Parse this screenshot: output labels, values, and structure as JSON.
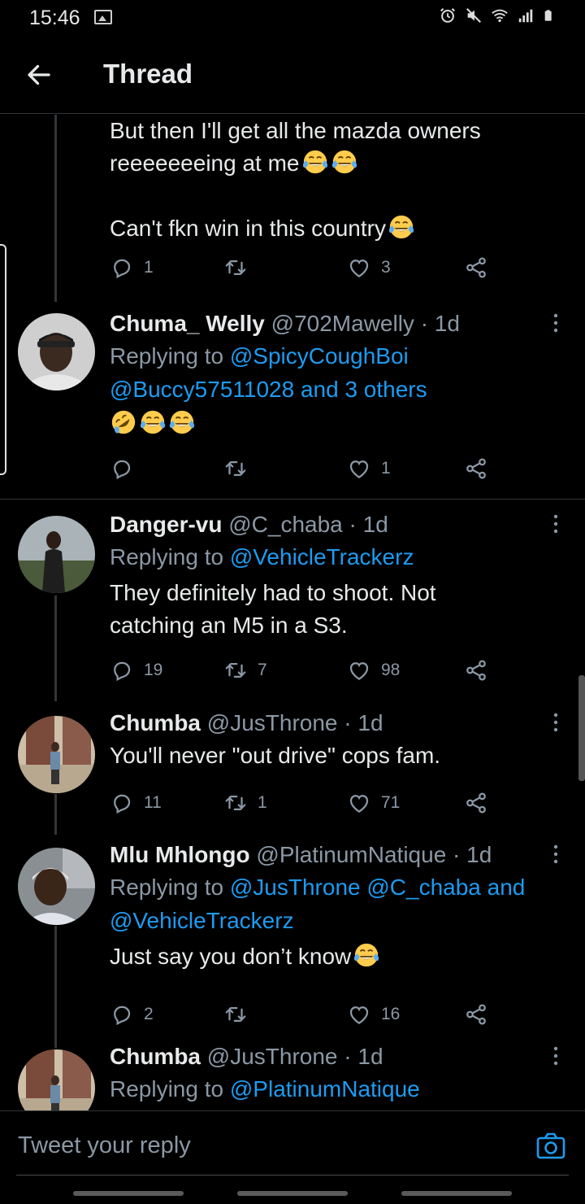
{
  "status_bar": {
    "time": "15:46"
  },
  "header": {
    "title": "Thread"
  },
  "tweets": [
    {
      "lines": [
        "But then I'll get all the mazda owners",
        "reeeeeeeing at me",
        "Can't fkn win in this country"
      ],
      "counts": {
        "replies": "1",
        "retweets": "",
        "likes": "3"
      }
    },
    {
      "name": "Chuma_ Welly",
      "handle": "@702Mawelly · 1d",
      "replying_prefix": "Replying to ",
      "replying_links": [
        "@SpicyCoughBoi",
        "@Buccy57511028 and 3 others"
      ],
      "counts": {
        "replies": "",
        "retweets": "",
        "likes": "1"
      }
    },
    {
      "name": "Danger-vu",
      "handle": "@C_chaba · 1d",
      "replying_prefix": "Replying to ",
      "replying_links": [
        "@VehicleTrackerz"
      ],
      "lines": [
        "They definitely had to shoot. Not",
        "catching an M5 in a S3."
      ],
      "counts": {
        "replies": "19",
        "retweets": "7",
        "likes": "98"
      }
    },
    {
      "name": "Chumba",
      "handle": "@JusThrone · 1d",
      "lines": [
        "You'll never \"out drive\" cops fam."
      ],
      "counts": {
        "replies": "11",
        "retweets": "1",
        "likes": "71"
      }
    },
    {
      "name": "Mlu Mhlongo",
      "handle": "@PlatinumNatique · 1d",
      "replying_prefix": "Replying to ",
      "replying_links": [
        "@JusThrone @C_chaba and",
        "@VehicleTrackerz"
      ],
      "lines": [
        "Just say you don’t know"
      ],
      "counts": {
        "replies": "2",
        "retweets": "",
        "likes": "16"
      }
    },
    {
      "name": "Chumba",
      "handle": "@JusThrone · 1d",
      "replying_prefix": "Replying to ",
      "replying_links": [
        "@PlatinumNatique"
      ]
    }
  ],
  "reply_box": {
    "placeholder": "Tweet your reply"
  },
  "icons": {
    "reply": "speech-bubble-icon",
    "retweet": "retweet-icon",
    "like": "heart-icon",
    "share": "share-icon",
    "more": "vertical-ellipsis-icon",
    "camera": "camera-icon",
    "emoji_joy": "face-with-tears-of-joy-emoji",
    "emoji_rofl": "rolling-on-floor-laughing-emoji"
  },
  "colors": {
    "background": "#000000",
    "accent": "#1d9bf0",
    "secondary_text": "#8b98a5"
  }
}
